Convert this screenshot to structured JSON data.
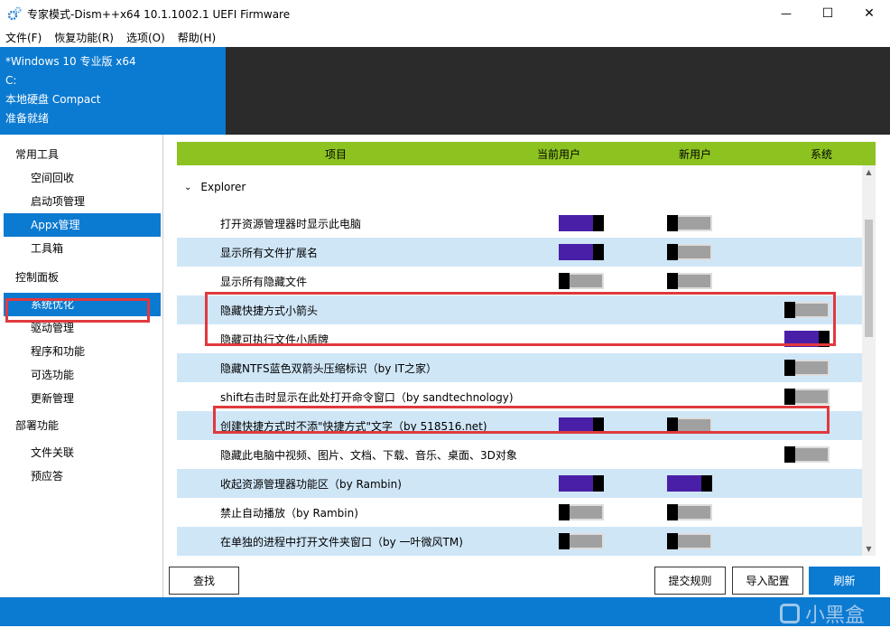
{
  "window": {
    "title": "专家模式-Dism++x64 10.1.1002.1 UEFI Firmware",
    "minimize_symbol": "—",
    "maximize_symbol": "☐",
    "close_symbol": "✕"
  },
  "menu": [
    "文件(F)",
    "恢复功能(R)",
    "选项(O)",
    "帮助(H)"
  ],
  "info": {
    "os": "*Windows 10 专业版 x64",
    "drive": "C:",
    "disk": "本地硬盘 Compact",
    "status": "准备就绪"
  },
  "sidebar": {
    "groups": [
      {
        "label": "常用工具",
        "items": [
          "空间回收",
          "启动项管理",
          "Appx管理",
          "工具箱"
        ]
      },
      {
        "label": "控制面板",
        "items": [
          "系统优化",
          "驱动管理",
          "程序和功能",
          "可选功能",
          "更新管理"
        ]
      },
      {
        "label": "部署功能",
        "items": [
          "文件关联",
          "预应答"
        ]
      }
    ],
    "active_item": "系统优化",
    "highlighted_item": "Appx管理"
  },
  "table": {
    "headers": [
      "项目",
      "当前用户",
      "新用户",
      "系统"
    ],
    "section": "Explorer",
    "rows": [
      {
        "label": "打开资源管理器时显示此电脑",
        "cur": "on",
        "new": "off",
        "sys": null
      },
      {
        "label": "显示所有文件扩展名",
        "cur": "on",
        "new": "off",
        "sys": null
      },
      {
        "label": "显示所有隐藏文件",
        "cur": "off",
        "new": "off",
        "sys": null
      },
      {
        "label": "隐藏快捷方式小箭头",
        "cur": null,
        "new": null,
        "sys": "off"
      },
      {
        "label": "隐藏可执行文件小盾牌",
        "cur": null,
        "new": null,
        "sys": "on"
      },
      {
        "label": "隐藏NTFS蓝色双箭头压缩标识（by IT之家）",
        "cur": null,
        "new": null,
        "sys": "off"
      },
      {
        "label": "shift右击时显示在此处打开命令窗口（by sandtechnology)",
        "cur": null,
        "new": null,
        "sys": "off"
      },
      {
        "label": "创建快捷方式时不添\"快捷方式\"文字（by 518516.net)",
        "cur": "on",
        "new": "off",
        "sys": null
      },
      {
        "label": "隐藏此电脑中视频、图片、文档、下载、音乐、桌面、3D对象",
        "cur": null,
        "new": null,
        "sys": "off"
      },
      {
        "label": "收起资源管理器功能区（by Rambin)",
        "cur": "on",
        "new": "on",
        "sys": null
      },
      {
        "label": "禁止自动播放（by Rambin)",
        "cur": "off",
        "new": "off",
        "sys": null
      },
      {
        "label": "在单独的进程中打开文件夹窗口（by 一叶微风TM)",
        "cur": "off",
        "new": "off",
        "sys": null
      }
    ]
  },
  "buttons": {
    "find": "查找",
    "submit_rules": "提交规则",
    "import_config": "导入配置",
    "refresh": "刷新"
  },
  "watermark": "小黑盒",
  "colors": {
    "accent": "#0b7ad1",
    "header": "#8cc320",
    "toggle_on": "#4a1fa8",
    "highlight_box": "#e0393e"
  }
}
